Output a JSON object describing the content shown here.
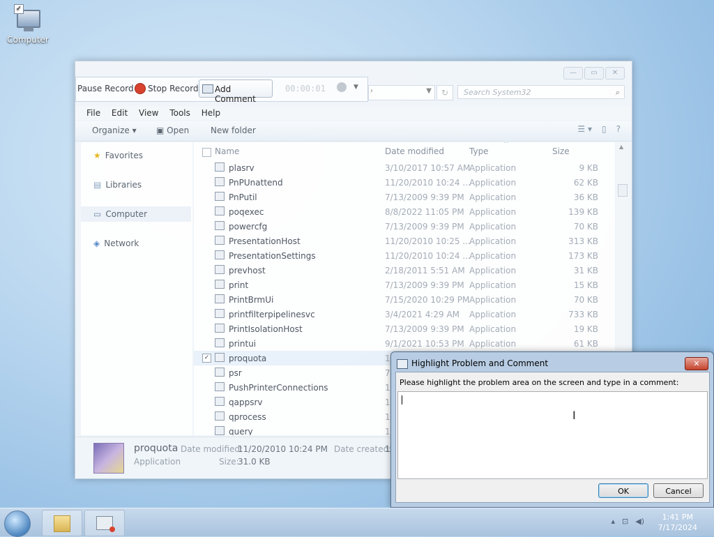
{
  "desktop": {
    "computer_label": "Computer"
  },
  "explorer": {
    "search_placeholder": "Search System32",
    "menu": [
      "File",
      "Edit",
      "View",
      "Tools",
      "Help"
    ],
    "toolbar": {
      "organize": "Organize ▾",
      "open": "Open",
      "new_folder": "New folder"
    },
    "nav": {
      "favorites": "Favorites",
      "libraries": "Libraries",
      "computer": "Computer",
      "network": "Network"
    },
    "columns": {
      "name": "Name",
      "date": "Date modified",
      "type": "Type",
      "size": "Size"
    },
    "rows": [
      {
        "name": "plasrv",
        "date": "3/10/2017 10:57 AM",
        "type": "Application",
        "size": "9 KB"
      },
      {
        "name": "PnPUnattend",
        "date": "11/20/2010 10:24 ...",
        "type": "Application",
        "size": "62 KB"
      },
      {
        "name": "PnPutil",
        "date": "7/13/2009 9:39 PM",
        "type": "Application",
        "size": "36 KB"
      },
      {
        "name": "poqexec",
        "date": "8/8/2022 11:05 PM",
        "type": "Application",
        "size": "139 KB"
      },
      {
        "name": "powercfg",
        "date": "7/13/2009 9:39 PM",
        "type": "Application",
        "size": "70 KB"
      },
      {
        "name": "PresentationHost",
        "date": "11/20/2010 10:25 ...",
        "type": "Application",
        "size": "313 KB"
      },
      {
        "name": "PresentationSettings",
        "date": "11/20/2010 10:24 ...",
        "type": "Application",
        "size": "173 KB"
      },
      {
        "name": "prevhost",
        "date": "2/18/2011 5:51 AM",
        "type": "Application",
        "size": "31 KB"
      },
      {
        "name": "print",
        "date": "7/13/2009 9:39 PM",
        "type": "Application",
        "size": "15 KB"
      },
      {
        "name": "PrintBrmUi",
        "date": "7/15/2020 10:29 PM",
        "type": "Application",
        "size": "70 KB"
      },
      {
        "name": "printfilterpipelinesvc",
        "date": "3/4/2021 4:29 AM",
        "type": "Application",
        "size": "733 KB"
      },
      {
        "name": "PrintIsolationHost",
        "date": "7/13/2009 9:39 PM",
        "type": "Application",
        "size": "19 KB"
      },
      {
        "name": "printui",
        "date": "9/1/2021 10:53 PM",
        "type": "Application",
        "size": "61 KB"
      },
      {
        "name": "proquota",
        "date": "1",
        "type": "",
        "size": ""
      },
      {
        "name": "psr",
        "date": "7",
        "type": "",
        "size": ""
      },
      {
        "name": "PushPrinterConnections",
        "date": "1",
        "type": "",
        "size": ""
      },
      {
        "name": "qappsrv",
        "date": "1",
        "type": "",
        "size": ""
      },
      {
        "name": "qprocess",
        "date": "1",
        "type": "",
        "size": ""
      },
      {
        "name": "query",
        "date": "1",
        "type": "",
        "size": ""
      }
    ],
    "details": {
      "name": "proquota",
      "kind": "Application",
      "date_modified_label": "Date modified:",
      "date_modified": "11/20/2010 10:24 PM",
      "size_label": "Size:",
      "size": "31.0 KB",
      "date_created_label": "Date created:",
      "date_created": "1"
    }
  },
  "recorder": {
    "pause": "Pause Record",
    "stop": "Stop Record",
    "add_comment": "Add Comment",
    "timer": "00:00:01"
  },
  "dialog": {
    "title": "Highlight Problem and Comment",
    "prompt": "Please highlight the problem area on the screen and type in a comment:",
    "comment": "",
    "ok": "OK",
    "cancel": "Cancel",
    "close": "✕"
  },
  "taskbar": {
    "time": "1:41 PM",
    "date": "7/17/2024"
  }
}
